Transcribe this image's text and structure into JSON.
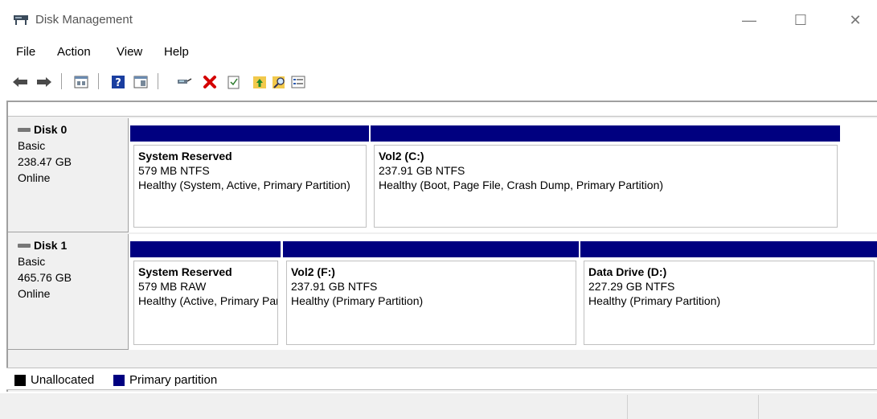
{
  "window": {
    "title": "Disk Management",
    "minimize_glyph": "—",
    "maximize_glyph": "☐",
    "close_glyph": "✕"
  },
  "menu": {
    "file": "File",
    "action": "Action",
    "view": "View",
    "help": "Help"
  },
  "toolbar": {
    "icons": [
      "back-icon",
      "forward-icon",
      "properties-icon",
      "help-icon",
      "show-hide-icon",
      "connect-icon",
      "delete-icon",
      "check-icon",
      "up-icon",
      "search-icon",
      "list-icon"
    ]
  },
  "disks": [
    {
      "name": "Disk 0",
      "type": "Basic",
      "size": "238.47 GB",
      "status": "Online",
      "partitions": [
        {
          "name": "System Reserved",
          "size": "579 MB NTFS",
          "status": "Healthy (System, Active, Primary Partition)"
        },
        {
          "name": "Vol2  (C:)",
          "size": "237.91 GB NTFS",
          "status": "Healthy (Boot, Page File, Crash Dump, Primary Partition)"
        }
      ]
    },
    {
      "name": "Disk 1",
      "type": "Basic",
      "size": "465.76 GB",
      "status": "Online",
      "partitions": [
        {
          "name": "System Reserved",
          "size": "579 MB RAW",
          "status": "Healthy (Active, Primary Partition)"
        },
        {
          "name": "Vol2  (F:)",
          "size": "237.91 GB NTFS",
          "status": "Healthy (Primary Partition)"
        },
        {
          "name": "Data Drive  (D:)",
          "size": "227.29 GB NTFS",
          "status": "Healthy (Primary Partition)"
        }
      ]
    }
  ],
  "legend": {
    "unallocated": "Unallocated",
    "primary": "Primary partition"
  },
  "colors": {
    "primary_partition": "#000080",
    "unallocated": "#000000"
  }
}
